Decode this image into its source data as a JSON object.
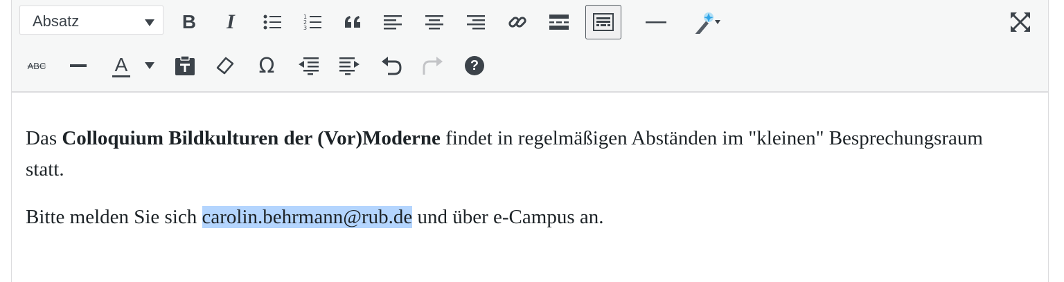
{
  "toolbar": {
    "format_select": {
      "value": "Absatz"
    },
    "row1": [
      "bold-icon",
      "italic-icon",
      "bullet-list-icon",
      "numbered-list-icon",
      "blockquote-icon",
      "align-left-icon",
      "align-center-icon",
      "align-right-icon",
      "link-icon",
      "read-more-icon",
      "toolbar-toggle-icon",
      "horizontal-rule-icon",
      "magic-wand-icon",
      "fullscreen-icon"
    ],
    "row2": [
      "strikethrough-icon",
      "horizontal-line-icon",
      "text-color-icon",
      "paste-as-text-icon",
      "clear-formatting-icon",
      "special-character-icon",
      "outdent-icon",
      "indent-icon",
      "undo-icon",
      "redo-icon",
      "help-icon"
    ],
    "bold_label": "B",
    "italic_label": "I",
    "strike_label": "ABC",
    "text_color_label": "A",
    "omega_label": "Ω",
    "help_label": "?"
  },
  "content": {
    "p1": {
      "pre": "Das ",
      "bold": "Colloquium Bildkulturen der (Vor)Moderne",
      "post": " findet in regelmäßigen Abständen im \"kleinen\" Besprechungsraum statt."
    },
    "p2": {
      "pre": "Bitte melden Sie sich ",
      "selected": "carolin.behrmann@rub.de",
      "post": " und über e-Campus an."
    }
  },
  "colors": {
    "toolbar_bg": "#f6f7f7",
    "selection": "#b4d5fe",
    "icon": "#3c434a",
    "disabled_icon": "#c3c4c7"
  }
}
